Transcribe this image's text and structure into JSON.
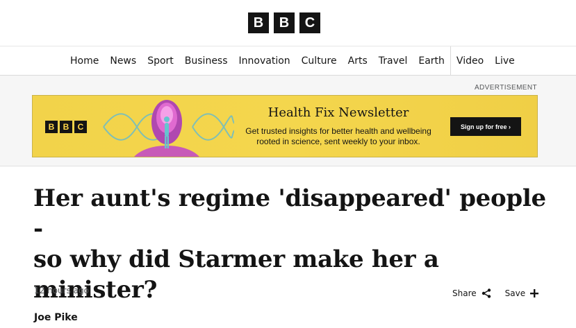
{
  "brand": {
    "letters": [
      "B",
      "B",
      "C"
    ]
  },
  "nav": {
    "items": [
      "Home",
      "News",
      "Sport",
      "Business",
      "Innovation",
      "Culture",
      "Arts",
      "Travel",
      "Earth",
      "Video",
      "Live"
    ]
  },
  "ad": {
    "label": "ADVERTISEMENT",
    "brand_letters": [
      "B",
      "B",
      "C"
    ],
    "title": "Health Fix Newsletter",
    "description_line1": "Get trusted insights for better health and wellbeing",
    "description_line2": "rooted in science, sent weekly to your inbox.",
    "cta": "Sign up for free ›",
    "colors": {
      "background": "#f2d34a",
      "cta": "#141414"
    }
  },
  "article": {
    "headline_line1": "Her aunt's regime 'disappeared' people -",
    "headline_line2": "so why did Starmer make her a",
    "headline_line3": "minister?",
    "timestamp": "12 hours ago",
    "share_label": "Share",
    "save_label": "Save",
    "author": "Joe Pike",
    "author_role": ""
  },
  "icons": {
    "share": "share-icon",
    "save": "plus-icon"
  }
}
